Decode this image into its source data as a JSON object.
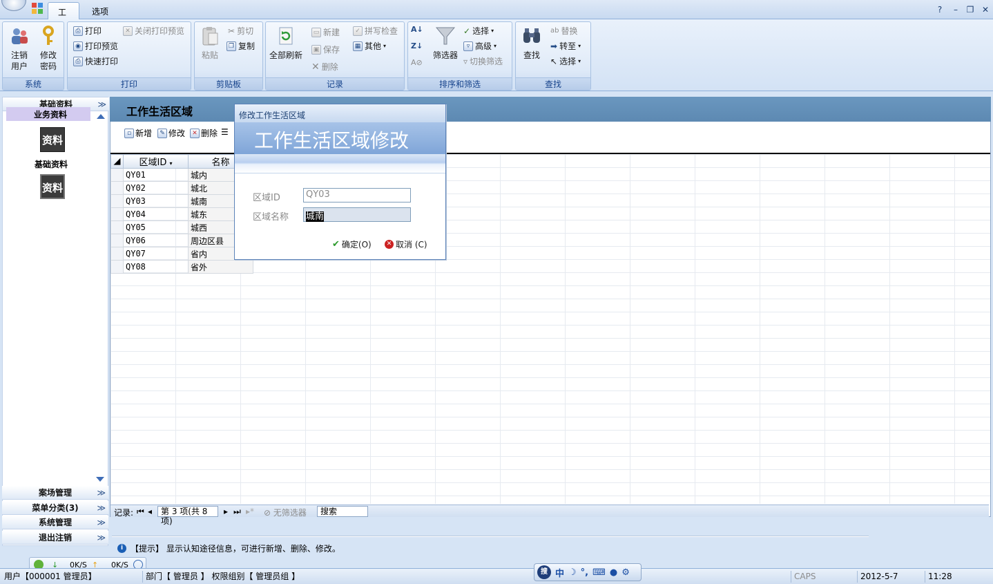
{
  "tabs": {
    "tools": "工具",
    "options": "选项"
  },
  "window_buttons": {
    "help": "?",
    "minimize": "–",
    "restore": "❐",
    "close": "✕"
  },
  "ribbon": {
    "system": {
      "label": "系统",
      "logout": "注销\n用户",
      "change_pwd": "修改\n密码"
    },
    "print": {
      "label": "打印",
      "print": "打印",
      "preview": "打印预览",
      "quick": "快速打印",
      "close_preview": "关闭打印预览"
    },
    "clipboard": {
      "label": "剪贴板",
      "paste": "粘贴",
      "cut": "剪切",
      "copy": "复制"
    },
    "records": {
      "label": "记录",
      "refresh_all": "全部刷新",
      "new": "新建",
      "save": "保存",
      "delete": "删除",
      "spell": "拼写检查",
      "other": "其他"
    },
    "sort_filter": {
      "label": "排序和筛选",
      "filter": "筛选器",
      "select": "选择",
      "advanced": "高级",
      "toggle": "切换筛选"
    },
    "find": {
      "label": "查找",
      "find": "查找",
      "replace": "替换",
      "goto": "转至",
      "select": "选择"
    }
  },
  "nav": {
    "header": "基础资料",
    "chev": "≫",
    "icon_text": "资料",
    "items": [
      "基础资料",
      "业务资料"
    ],
    "sections": [
      "案场管理",
      "菜单分类(3)",
      "系统管理",
      "退出注销"
    ]
  },
  "main": {
    "title": "工作生活区域",
    "toolbar": {
      "new": "新增",
      "edit": "修改",
      "delete": "删除"
    },
    "columns": [
      "区域ID",
      "名称"
    ],
    "rows": [
      {
        "id": "QY01",
        "name": "城内"
      },
      {
        "id": "QY02",
        "name": "城北"
      },
      {
        "id": "QY03",
        "name": "城南"
      },
      {
        "id": "QY04",
        "name": "城东"
      },
      {
        "id": "QY05",
        "name": "城西"
      },
      {
        "id": "QY06",
        "name": "周边区县"
      },
      {
        "id": "QY07",
        "name": "省内"
      },
      {
        "id": "QY08",
        "name": "省外"
      }
    ],
    "recnav": {
      "label": "记录:",
      "position": "第 3 项(共 8 项)",
      "no_filter": "无筛选器",
      "search": "搜索"
    },
    "hint": "【提示】 显示认知途径信息，可进行新增、删除、修改。"
  },
  "dialog": {
    "title": "修改工作生活区域",
    "banner": "工作生活区域修改",
    "id_label": "区域ID",
    "id_value": "QY03",
    "name_label": "区域名称",
    "name_value": "城南",
    "ok": "确定(O)",
    "cancel": "取消 (C)"
  },
  "network": {
    "down": "0K/S",
    "up": "0K/S"
  },
  "ime": {
    "logo": "搜",
    "mode": "中",
    "moon": "☽",
    "punct": "°,"
  },
  "status": {
    "user": "用户【000001 管理员】",
    "dept": "部门【 管理员 】 权限组别【 管理员组 】",
    "caps": "CAPS",
    "date": "2012-5-7",
    "time": "11:28"
  },
  "colors": {
    "accent": "#5d89b2",
    "ribbon_label": "#15428b",
    "nav_selected": "#d3cbf0"
  }
}
